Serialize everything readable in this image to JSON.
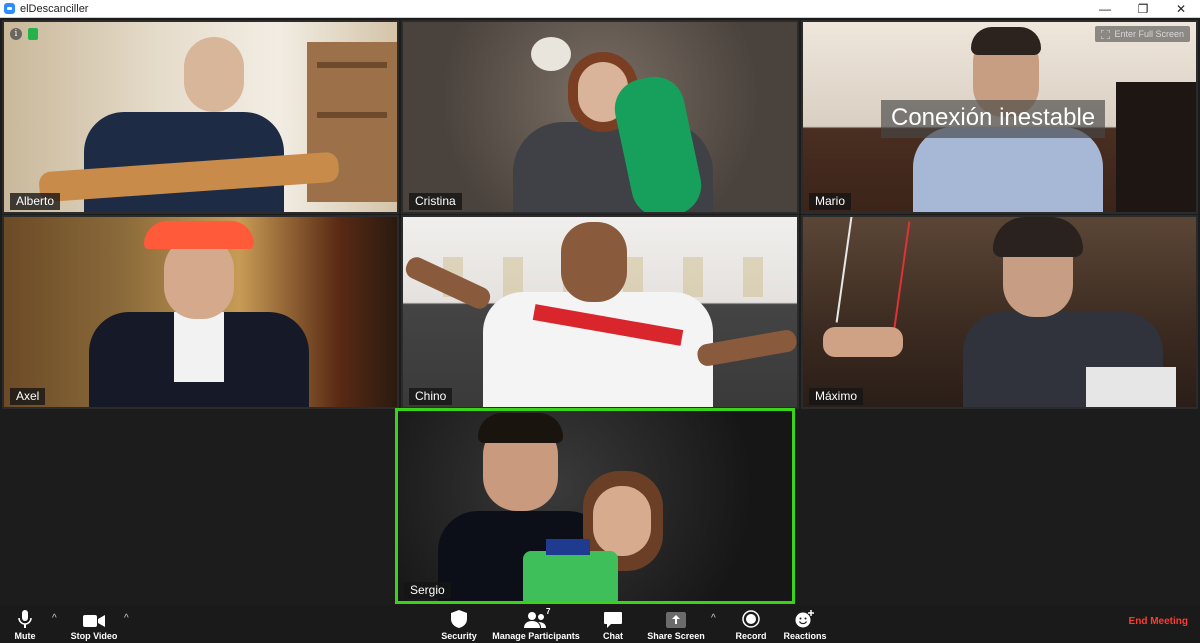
{
  "window": {
    "title": "elDescanciller",
    "minimize": "—",
    "restore": "❐",
    "close": "✕"
  },
  "overlay": {
    "fullscreen_label": "Enter Full Screen",
    "unstable_text": "Conexión inestable",
    "info_glyph": "i"
  },
  "participants": [
    {
      "name": "Alberto"
    },
    {
      "name": "Cristina"
    },
    {
      "name": "Mario"
    },
    {
      "name": "Axel"
    },
    {
      "name": "Chino"
    },
    {
      "name": "Máximo"
    },
    {
      "name": "Sergio",
      "active": true
    }
  ],
  "toolbar": {
    "mute": "Mute",
    "stop_video": "Stop Video",
    "security": "Security",
    "manage_participants": "Manage Participants",
    "participant_count": "7",
    "chat": "Chat",
    "share_screen": "Share Screen",
    "record": "Record",
    "reactions": "Reactions",
    "end_meeting": "End Meeting",
    "caret": "^"
  },
  "colors": {
    "active_speaker_border": "#39d31a",
    "end_meeting": "#ff3b30",
    "toolbar_bg": "#1a1a1a"
  }
}
